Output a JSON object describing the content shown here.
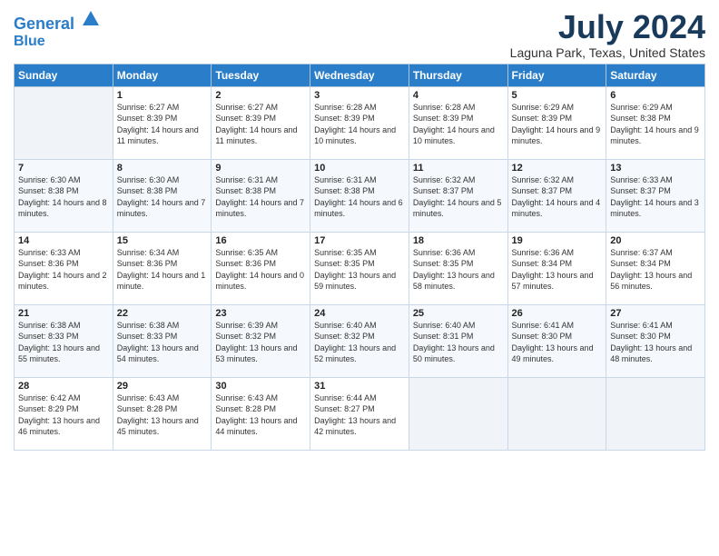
{
  "logo": {
    "line1": "General",
    "line2": "Blue"
  },
  "title": "July 2024",
  "location": "Laguna Park, Texas, United States",
  "weekdays": [
    "Sunday",
    "Monday",
    "Tuesday",
    "Wednesday",
    "Thursday",
    "Friday",
    "Saturday"
  ],
  "weeks": [
    [
      {
        "day": "",
        "sunrise": "",
        "sunset": "",
        "daylight": ""
      },
      {
        "day": "1",
        "sunrise": "Sunrise: 6:27 AM",
        "sunset": "Sunset: 8:39 PM",
        "daylight": "Daylight: 14 hours and 11 minutes."
      },
      {
        "day": "2",
        "sunrise": "Sunrise: 6:27 AM",
        "sunset": "Sunset: 8:39 PM",
        "daylight": "Daylight: 14 hours and 11 minutes."
      },
      {
        "day": "3",
        "sunrise": "Sunrise: 6:28 AM",
        "sunset": "Sunset: 8:39 PM",
        "daylight": "Daylight: 14 hours and 10 minutes."
      },
      {
        "day": "4",
        "sunrise": "Sunrise: 6:28 AM",
        "sunset": "Sunset: 8:39 PM",
        "daylight": "Daylight: 14 hours and 10 minutes."
      },
      {
        "day": "5",
        "sunrise": "Sunrise: 6:29 AM",
        "sunset": "Sunset: 8:39 PM",
        "daylight": "Daylight: 14 hours and 9 minutes."
      },
      {
        "day": "6",
        "sunrise": "Sunrise: 6:29 AM",
        "sunset": "Sunset: 8:38 PM",
        "daylight": "Daylight: 14 hours and 9 minutes."
      }
    ],
    [
      {
        "day": "7",
        "sunrise": "Sunrise: 6:30 AM",
        "sunset": "Sunset: 8:38 PM",
        "daylight": "Daylight: 14 hours and 8 minutes."
      },
      {
        "day": "8",
        "sunrise": "Sunrise: 6:30 AM",
        "sunset": "Sunset: 8:38 PM",
        "daylight": "Daylight: 14 hours and 7 minutes."
      },
      {
        "day": "9",
        "sunrise": "Sunrise: 6:31 AM",
        "sunset": "Sunset: 8:38 PM",
        "daylight": "Daylight: 14 hours and 7 minutes."
      },
      {
        "day": "10",
        "sunrise": "Sunrise: 6:31 AM",
        "sunset": "Sunset: 8:38 PM",
        "daylight": "Daylight: 14 hours and 6 minutes."
      },
      {
        "day": "11",
        "sunrise": "Sunrise: 6:32 AM",
        "sunset": "Sunset: 8:37 PM",
        "daylight": "Daylight: 14 hours and 5 minutes."
      },
      {
        "day": "12",
        "sunrise": "Sunrise: 6:32 AM",
        "sunset": "Sunset: 8:37 PM",
        "daylight": "Daylight: 14 hours and 4 minutes."
      },
      {
        "day": "13",
        "sunrise": "Sunrise: 6:33 AM",
        "sunset": "Sunset: 8:37 PM",
        "daylight": "Daylight: 14 hours and 3 minutes."
      }
    ],
    [
      {
        "day": "14",
        "sunrise": "Sunrise: 6:33 AM",
        "sunset": "Sunset: 8:36 PM",
        "daylight": "Daylight: 14 hours and 2 minutes."
      },
      {
        "day": "15",
        "sunrise": "Sunrise: 6:34 AM",
        "sunset": "Sunset: 8:36 PM",
        "daylight": "Daylight: 14 hours and 1 minute."
      },
      {
        "day": "16",
        "sunrise": "Sunrise: 6:35 AM",
        "sunset": "Sunset: 8:36 PM",
        "daylight": "Daylight: 14 hours and 0 minutes."
      },
      {
        "day": "17",
        "sunrise": "Sunrise: 6:35 AM",
        "sunset": "Sunset: 8:35 PM",
        "daylight": "Daylight: 13 hours and 59 minutes."
      },
      {
        "day": "18",
        "sunrise": "Sunrise: 6:36 AM",
        "sunset": "Sunset: 8:35 PM",
        "daylight": "Daylight: 13 hours and 58 minutes."
      },
      {
        "day": "19",
        "sunrise": "Sunrise: 6:36 AM",
        "sunset": "Sunset: 8:34 PM",
        "daylight": "Daylight: 13 hours and 57 minutes."
      },
      {
        "day": "20",
        "sunrise": "Sunrise: 6:37 AM",
        "sunset": "Sunset: 8:34 PM",
        "daylight": "Daylight: 13 hours and 56 minutes."
      }
    ],
    [
      {
        "day": "21",
        "sunrise": "Sunrise: 6:38 AM",
        "sunset": "Sunset: 8:33 PM",
        "daylight": "Daylight: 13 hours and 55 minutes."
      },
      {
        "day": "22",
        "sunrise": "Sunrise: 6:38 AM",
        "sunset": "Sunset: 8:33 PM",
        "daylight": "Daylight: 13 hours and 54 minutes."
      },
      {
        "day": "23",
        "sunrise": "Sunrise: 6:39 AM",
        "sunset": "Sunset: 8:32 PM",
        "daylight": "Daylight: 13 hours and 53 minutes."
      },
      {
        "day": "24",
        "sunrise": "Sunrise: 6:40 AM",
        "sunset": "Sunset: 8:32 PM",
        "daylight": "Daylight: 13 hours and 52 minutes."
      },
      {
        "day": "25",
        "sunrise": "Sunrise: 6:40 AM",
        "sunset": "Sunset: 8:31 PM",
        "daylight": "Daylight: 13 hours and 50 minutes."
      },
      {
        "day": "26",
        "sunrise": "Sunrise: 6:41 AM",
        "sunset": "Sunset: 8:30 PM",
        "daylight": "Daylight: 13 hours and 49 minutes."
      },
      {
        "day": "27",
        "sunrise": "Sunrise: 6:41 AM",
        "sunset": "Sunset: 8:30 PM",
        "daylight": "Daylight: 13 hours and 48 minutes."
      }
    ],
    [
      {
        "day": "28",
        "sunrise": "Sunrise: 6:42 AM",
        "sunset": "Sunset: 8:29 PM",
        "daylight": "Daylight: 13 hours and 46 minutes."
      },
      {
        "day": "29",
        "sunrise": "Sunrise: 6:43 AM",
        "sunset": "Sunset: 8:28 PM",
        "daylight": "Daylight: 13 hours and 45 minutes."
      },
      {
        "day": "30",
        "sunrise": "Sunrise: 6:43 AM",
        "sunset": "Sunset: 8:28 PM",
        "daylight": "Daylight: 13 hours and 44 minutes."
      },
      {
        "day": "31",
        "sunrise": "Sunrise: 6:44 AM",
        "sunset": "Sunset: 8:27 PM",
        "daylight": "Daylight: 13 hours and 42 minutes."
      },
      {
        "day": "",
        "sunrise": "",
        "sunset": "",
        "daylight": ""
      },
      {
        "day": "",
        "sunrise": "",
        "sunset": "",
        "daylight": ""
      },
      {
        "day": "",
        "sunrise": "",
        "sunset": "",
        "daylight": ""
      }
    ]
  ]
}
